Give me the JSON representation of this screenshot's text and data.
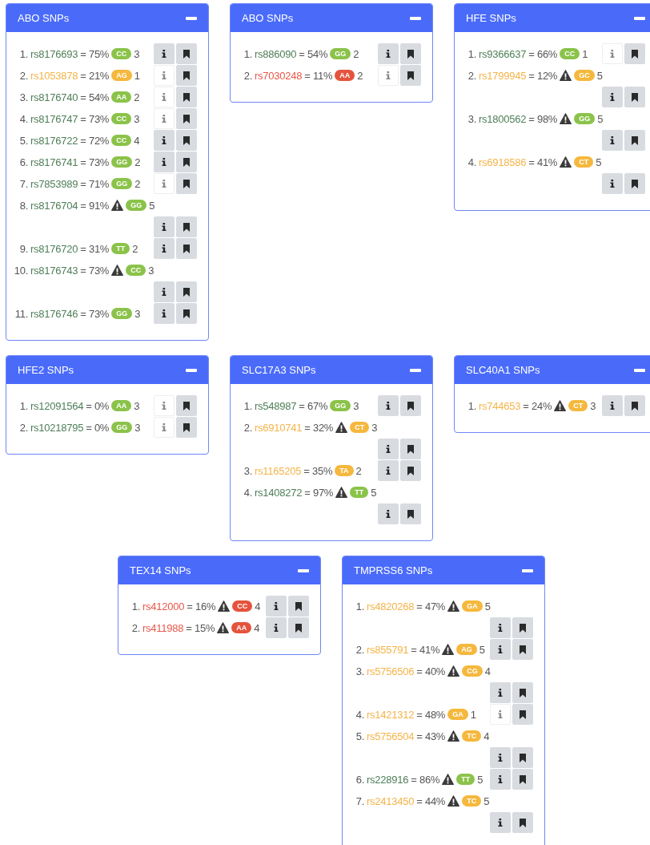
{
  "panels": [
    {
      "title": "ABO SNPs",
      "items": [
        {
          "number": "1.",
          "snp": "rs8176693",
          "value": "= 75%",
          "warning": false,
          "genotype": "CC",
          "color": "#8bc34a",
          "count": "3",
          "info_filled": true
        },
        {
          "number": "2.",
          "snp": "rs1053878",
          "value": "= 21%",
          "warning": false,
          "genotype": "AG",
          "color": "#f5b83d",
          "count": "1",
          "info_filled": false
        },
        {
          "number": "3.",
          "snp": "rs8176740",
          "value": "= 54%",
          "warning": false,
          "genotype": "AA",
          "color": "#8bc34a",
          "count": "2",
          "info_filled": false
        },
        {
          "number": "4.",
          "snp": "rs8176747",
          "value": "= 73%",
          "warning": false,
          "genotype": "CC",
          "color": "#8bc34a",
          "count": "3",
          "info_filled": false
        },
        {
          "number": "5.",
          "snp": "rs8176722",
          "value": "= 72%",
          "warning": false,
          "genotype": "CC",
          "color": "#8bc34a",
          "count": "4",
          "info_filled": true
        },
        {
          "number": "6.",
          "snp": "rs8176741",
          "value": "= 73%",
          "warning": false,
          "genotype": "GG",
          "color": "#8bc34a",
          "count": "2",
          "info_filled": true
        },
        {
          "number": "7.",
          "snp": "rs7853989",
          "value": "= 71%",
          "warning": false,
          "genotype": "GG",
          "color": "#8bc34a",
          "count": "2",
          "info_filled": false
        },
        {
          "number": "8.",
          "snp": "rs8176704",
          "value": "= 91%",
          "warning": true,
          "genotype": "GG",
          "color": "#8bc34a",
          "count": "5",
          "info_filled": true
        },
        {
          "number": "9.",
          "snp": "rs8176720",
          "value": "= 31%",
          "warning": false,
          "genotype": "TT",
          "color": "#8bc34a",
          "count": "2",
          "info_filled": true
        },
        {
          "number": "10.",
          "snp": "rs8176743",
          "value": "= 73%",
          "warning": true,
          "genotype": "CC",
          "color": "#8bc34a",
          "count": "3",
          "info_filled": true
        },
        {
          "number": "11.",
          "snp": "rs8176746",
          "value": "= 73%",
          "warning": false,
          "genotype": "GG",
          "color": "#8bc34a",
          "count": "3",
          "info_filled": true
        }
      ]
    },
    {
      "title": "ABO SNPs",
      "items": [
        {
          "number": "1.",
          "snp": "rs886090",
          "value": "= 54%",
          "warning": false,
          "genotype": "GG",
          "color": "#8bc34a",
          "count": "2",
          "info_filled": true
        },
        {
          "number": "2.",
          "snp": "rs7030248",
          "value": "= 11%",
          "warning": false,
          "genotype": "AA",
          "color": "#e5533d",
          "count": "2",
          "info_filled": false
        }
      ]
    },
    {
      "title": "HFE SNPs",
      "items": [
        {
          "number": "1.",
          "snp": "rs9366637",
          "value": "= 66%",
          "warning": false,
          "genotype": "CC",
          "color": "#8bc34a",
          "count": "1",
          "info_filled": false
        },
        {
          "number": "2.",
          "snp": "rs1799945",
          "value": "= 12%",
          "warning": true,
          "genotype": "GC",
          "color": "#f5b83d",
          "count": "5",
          "info_filled": true
        },
        {
          "number": "3.",
          "snp": "rs1800562",
          "value": "= 98%",
          "warning": true,
          "genotype": "GG",
          "color": "#8bc34a",
          "count": "5",
          "info_filled": true
        },
        {
          "number": "4.",
          "snp": "rs6918586",
          "value": "= 41%",
          "warning": true,
          "genotype": "CT",
          "color": "#f5b83d",
          "count": "5",
          "info_filled": true
        }
      ]
    },
    {
      "title": "HFE2 SNPs",
      "items": [
        {
          "number": "1.",
          "snp": "rs12091564",
          "value": "= 0%",
          "warning": false,
          "genotype": "AA",
          "color": "#8bc34a",
          "count": "3",
          "info_filled": false
        },
        {
          "number": "2.",
          "snp": "rs10218795",
          "value": "= 0%",
          "warning": false,
          "genotype": "GG",
          "color": "#8bc34a",
          "count": "3",
          "info_filled": false
        }
      ]
    },
    {
      "title": "SLC17A3 SNPs",
      "items": [
        {
          "number": "1.",
          "snp": "rs548987",
          "value": "= 67%",
          "warning": false,
          "genotype": "GG",
          "color": "#8bc34a",
          "count": "3",
          "info_filled": true
        },
        {
          "number": "2.",
          "snp": "rs6910741",
          "value": "= 32%",
          "warning": true,
          "genotype": "CT",
          "color": "#f5b83d",
          "count": "3",
          "info_filled": true
        },
        {
          "number": "3.",
          "snp": "rs1165205",
          "value": "= 35%",
          "warning": false,
          "genotype": "TA",
          "color": "#f5b83d",
          "count": "2",
          "info_filled": true
        },
        {
          "number": "4.",
          "snp": "rs1408272",
          "value": "= 97%",
          "warning": true,
          "genotype": "TT",
          "color": "#8bc34a",
          "count": "5",
          "info_filled": true
        }
      ]
    },
    {
      "title": "SLC40A1 SNPs",
      "items": [
        {
          "number": "1.",
          "snp": "rs744653",
          "value": "= 24%",
          "warning": true,
          "genotype": "CT",
          "color": "#f5b83d",
          "count": "3",
          "info_filled": true
        }
      ]
    },
    {
      "title": "TEX14 SNPs",
      "items": [
        {
          "number": "1.",
          "snp": "rs412000",
          "value": "= 16%",
          "warning": true,
          "genotype": "CC",
          "color": "#e5533d",
          "count": "4",
          "info_filled": true
        },
        {
          "number": "2.",
          "snp": "rs411988",
          "value": "= 15%",
          "warning": true,
          "genotype": "AA",
          "color": "#e5533d",
          "count": "4",
          "info_filled": true
        }
      ]
    },
    {
      "title": "TMPRSS6 SNPs",
      "items": [
        {
          "number": "1.",
          "snp": "rs4820268",
          "value": "= 47%",
          "warning": true,
          "genotype": "GA",
          "color": "#f5b83d",
          "count": "5",
          "info_filled": true
        },
        {
          "number": "2.",
          "snp": "rs855791",
          "value": "= 41%",
          "warning": true,
          "genotype": "AG",
          "color": "#f5b83d",
          "count": "5",
          "info_filled": true
        },
        {
          "number": "3.",
          "snp": "rs5756506",
          "value": "= 40%",
          "warning": true,
          "genotype": "CG",
          "color": "#f5b83d",
          "count": "4",
          "info_filled": true
        },
        {
          "number": "4.",
          "snp": "rs1421312",
          "value": "= 48%",
          "warning": false,
          "genotype": "GA",
          "color": "#f5b83d",
          "count": "1",
          "info_filled": false
        },
        {
          "number": "5.",
          "snp": "rs5756504",
          "value": "= 43%",
          "warning": true,
          "genotype": "TC",
          "color": "#f5b83d",
          "count": "4",
          "info_filled": true
        },
        {
          "number": "6.",
          "snp": "rs228916",
          "value": "= 86%",
          "warning": true,
          "genotype": "TT",
          "color": "#8bc34a",
          "count": "5",
          "info_filled": true
        },
        {
          "number": "7.",
          "snp": "rs2413450",
          "value": "= 44%",
          "warning": true,
          "genotype": "TC",
          "color": "#f5b83d",
          "count": "5",
          "info_filled": true
        }
      ]
    }
  ]
}
